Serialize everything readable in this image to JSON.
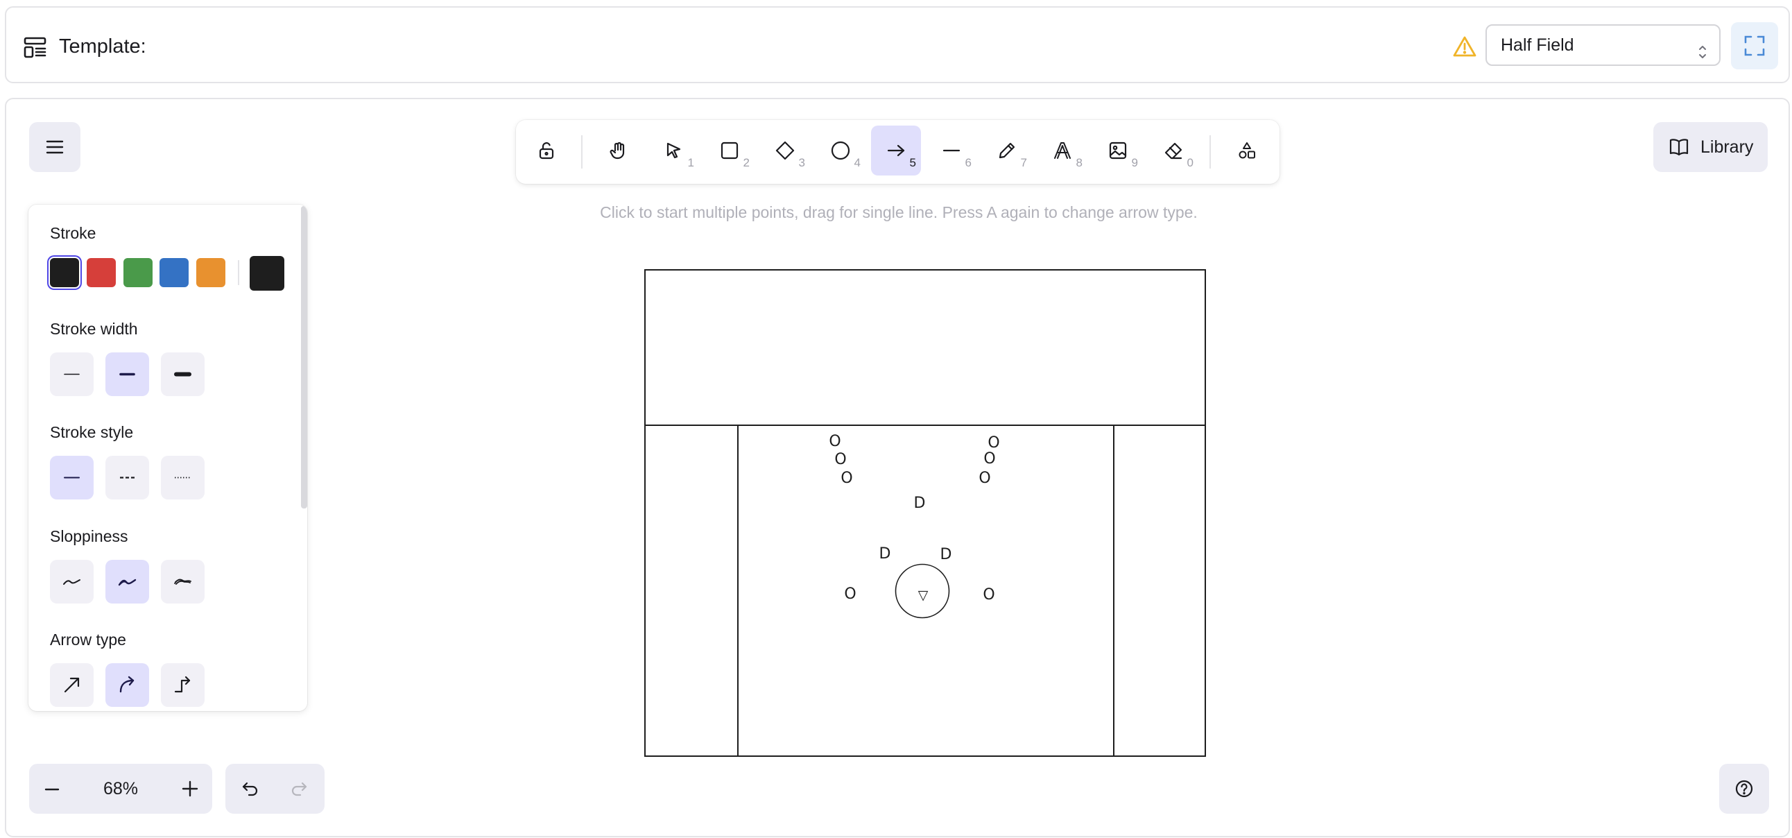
{
  "header": {
    "title": "Template:",
    "template_select": {
      "value": "Half Field"
    }
  },
  "toolbar": {
    "tools": [
      {
        "name": "lock",
        "key": ""
      },
      {
        "name": "hand",
        "key": ""
      },
      {
        "name": "selection",
        "key": "1"
      },
      {
        "name": "rectangle",
        "key": "2"
      },
      {
        "name": "diamond",
        "key": "3"
      },
      {
        "name": "ellipse",
        "key": "4"
      },
      {
        "name": "arrow",
        "key": "5",
        "active": true
      },
      {
        "name": "line",
        "key": "6"
      },
      {
        "name": "draw",
        "key": "7"
      },
      {
        "name": "text",
        "key": "8"
      },
      {
        "name": "image",
        "key": "9"
      },
      {
        "name": "eraser",
        "key": "0"
      },
      {
        "name": "extra-tools",
        "key": ""
      }
    ],
    "hint": "Click to start multiple points, drag for single line. Press A again to change arrow type."
  },
  "library": {
    "label": "Library"
  },
  "properties": {
    "stroke": {
      "label": "Stroke",
      "colors": [
        "#1e1e1e",
        "#d63f3a",
        "#4a9a4a",
        "#3472c4",
        "#e8912f"
      ],
      "selected": "#1e1e1e",
      "current": "#1e1e1e"
    },
    "stroke_width": {
      "label": "Stroke width",
      "options": [
        "thin",
        "bold",
        "extra-bold"
      ],
      "selected": "bold"
    },
    "stroke_style": {
      "label": "Stroke style",
      "options": [
        "solid",
        "dashed",
        "dotted"
      ],
      "selected": "solid"
    },
    "sloppiness": {
      "label": "Sloppiness",
      "options": [
        "architect",
        "artist",
        "cartoonist"
      ],
      "selected": "artist"
    },
    "arrow_type": {
      "label": "Arrow type",
      "options": [
        "sharp",
        "curved",
        "elbow"
      ],
      "selected": "curved"
    }
  },
  "zoom": {
    "value": "68%"
  },
  "colors": {
    "accent": "#e0dffc",
    "selection_ring": "#4f46e5",
    "warning": "#f0b429"
  },
  "field_labels": {
    "attacker": "O",
    "defender": "D",
    "goalie": "▽"
  }
}
